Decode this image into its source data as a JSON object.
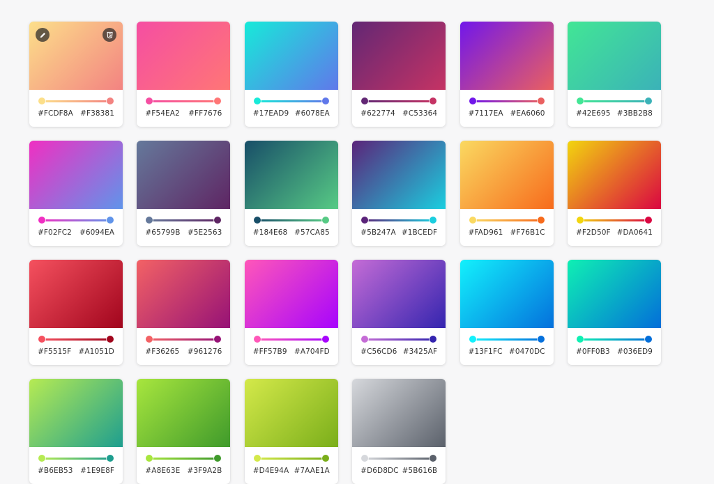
{
  "gradients": [
    {
      "c1": "#FCDF8A",
      "c2": "#F38381"
    },
    {
      "c1": "#F54EA2",
      "c2": "#FF7676"
    },
    {
      "c1": "#17EAD9",
      "c2": "#6078EA"
    },
    {
      "c1": "#622774",
      "c2": "#C53364"
    },
    {
      "c1": "#7117EA",
      "c2": "#EA6060"
    },
    {
      "c1": "#42E695",
      "c2": "#3BB2B8"
    },
    {
      "c1": "#F02FC2",
      "c2": "#6094EA"
    },
    {
      "c1": "#65799B",
      "c2": "#5E2563"
    },
    {
      "c1": "#184E68",
      "c2": "#57CA85"
    },
    {
      "c1": "#5B247A",
      "c2": "#1BCEDF"
    },
    {
      "c1": "#FAD961",
      "c2": "#F76B1C"
    },
    {
      "c1": "#F2D50F",
      "c2": "#DA0641"
    },
    {
      "c1": "#F5515F",
      "c2": "#A1051D"
    },
    {
      "c1": "#F36265",
      "c2": "#961276"
    },
    {
      "c1": "#FF57B9",
      "c2": "#A704FD"
    },
    {
      "c1": "#C56CD6",
      "c2": "#3425AF"
    },
    {
      "c1": "#13F1FC",
      "c2": "#0470DC"
    },
    {
      "c1": "#0FF0B3",
      "c2": "#036ED9"
    },
    {
      "c1": "#B6EB53",
      "c2": "#1E9E8F"
    },
    {
      "c1": "#A8E63E",
      "c2": "#3F9A2B"
    },
    {
      "c1": "#D4E94A",
      "c2": "#7AAE1A"
    },
    {
      "c1": "#D6D8DC",
      "c2": "#5B616B"
    }
  ],
  "hover_card_index": 0,
  "icons": {
    "edit": "pencil-icon",
    "css": "css-icon"
  }
}
